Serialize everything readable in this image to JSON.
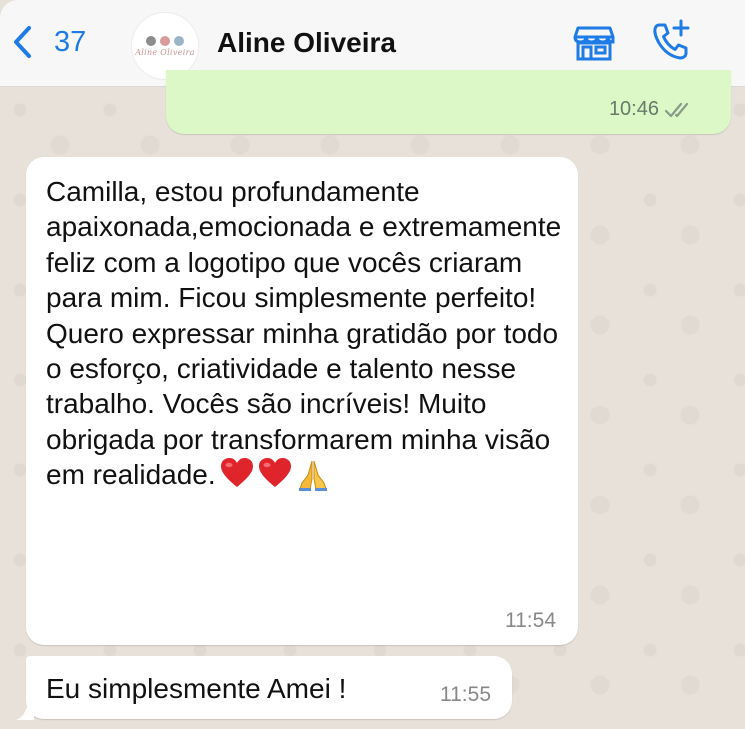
{
  "header": {
    "back_count": "37",
    "contact_name": "Aline Oliveira",
    "avatar_text": "Aline Oliveira",
    "icons": [
      "chevron-left-icon",
      "storefront-icon",
      "add-call-icon"
    ]
  },
  "messages": {
    "outgoing": {
      "time": "10:46",
      "status": "read"
    },
    "incoming_1": {
      "text": "Camilla, estou profundamente apaixonada,emocionada e extremamente feliz com a logotipo que vocês criaram para mim. Ficou simplesmente perfeito! Quero expressar minha gratidão por todo o esforço, criatividade e talento nesse trabalho. Vocês são incríveis! Muito obrigada por transformarem minha visão em realidade.",
      "emojis": [
        "red-heart",
        "red-heart",
        "folded-hands"
      ],
      "time": "11:54"
    },
    "incoming_2": {
      "text": "Eu simplesmente Amei !",
      "time": "11:55"
    }
  },
  "colors": {
    "accent_blue": "#1F7BE5",
    "outgoing_bubble": "#DCF8C6",
    "incoming_bubble": "#FFFFFF",
    "chat_background": "#E7E1D9"
  }
}
